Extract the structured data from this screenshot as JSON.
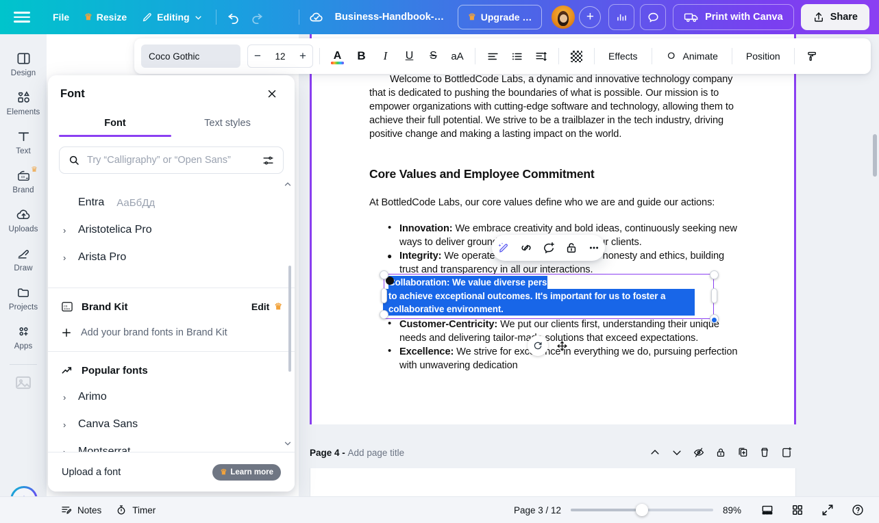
{
  "topbar": {
    "menu_icon": "hamburger-menu-icon",
    "file_label": "File",
    "resize_label": "Resize",
    "editing_label": "Editing",
    "undo_icon": "undo-icon",
    "redo_icon": "redo-icon",
    "cloud_icon": "cloud-saved-icon",
    "doc_title": "Business-Handbook-…",
    "upgrade_label": "Upgrade …",
    "insights_icon": "bar-chart-icon",
    "comment_icon": "comment-bubble-icon",
    "print_label": "Print with Canva",
    "share_label": "Share",
    "plus_label": "+"
  },
  "rail": {
    "items": [
      {
        "label": "Design",
        "icon": "design-icon"
      },
      {
        "label": "Elements",
        "icon": "elements-icon"
      },
      {
        "label": "Text",
        "icon": "text-icon"
      },
      {
        "label": "Brand",
        "icon": "brand-icon",
        "pro": true
      },
      {
        "label": "Uploads",
        "icon": "uploads-icon"
      },
      {
        "label": "Draw",
        "icon": "draw-icon"
      },
      {
        "label": "Projects",
        "icon": "projects-icon"
      },
      {
        "label": "Apps",
        "icon": "apps-icon"
      }
    ],
    "ai_assistant": "canva-ai-orb"
  },
  "toolbar": {
    "font_name": "Coco Gothic",
    "font_size": "12",
    "decrease_label": "−",
    "increase_label": "+",
    "text_color_icon": "text-color-A-icon",
    "bold_label": "B",
    "italic_label": "I",
    "underline_label": "U",
    "strikethrough_label": "S",
    "case_label": "aA",
    "align_icon": "align-left-icon",
    "list_icon": "bulleted-list-icon",
    "spacing_icon": "line-spacing-icon",
    "transparency_icon": "transparency-icon",
    "effects_label": "Effects",
    "animate_label": "Animate",
    "position_label": "Position",
    "copy_style_icon": "paint-roller-icon"
  },
  "font_panel": {
    "title": "Font",
    "close_icon": "close-icon",
    "tabs": [
      {
        "label": "Font",
        "active": true
      },
      {
        "label": "Text styles",
        "active": false
      }
    ],
    "search_placeholder": "Try “Calligraphy” or “Open Sans”",
    "search_value": "",
    "search_icon": "search-icon",
    "filter_icon": "filter-sliders-icon",
    "top_fonts": [
      {
        "name": "Entra",
        "sample": "АаБбДд",
        "chevron": false
      },
      {
        "name": "Aristotelica Pro",
        "sample": "",
        "chevron": true
      },
      {
        "name": "Arista Pro",
        "sample": "",
        "chevron": true
      }
    ],
    "brand_kit": {
      "title": "Brand Kit",
      "icon": "brand-kit-icon",
      "edit_label": "Edit",
      "add_label": "Add your brand fonts in Brand Kit",
      "add_icon": "plus-icon"
    },
    "popular": {
      "title": "Popular fonts",
      "icon": "trending-up-icon",
      "fonts": [
        {
          "name": "Arimo",
          "chevron": true
        },
        {
          "name": "Canva Sans",
          "chevron": true
        },
        {
          "name": "Montserrat",
          "chevron": true
        }
      ]
    },
    "footer": {
      "upload_label": "Upload a font",
      "learn_more_label": "Learn more"
    }
  },
  "document": {
    "intro": "Welcome to BottledCode Labs, a dynamic and innovative technology company that is dedicated to pushing the boundaries of what is possible. Our mission is to empower organizations with cutting-edge software and technology, allowing them to achieve their full potential. We strive to be a trailblazer in the tech industry, driving positive change and making a lasting impact on the world.",
    "heading": "Core Values and Employee Commitment",
    "lead": "At BottledCode Labs, our core values define who we are and guide our actions:",
    "bullets": [
      {
        "term": "Innovation:",
        "text": " We embrace creativity and bold ideas, continuously seeking new ways to deliver groundbreaking solutions for our clients."
      },
      {
        "term": "Integrity:",
        "text": " We operate with the highest level of honesty and ethics, building trust and transparency in all our interactions."
      },
      {
        "term": "Customer-Centricity:",
        "text": " We put our clients first, understanding their unique needs and delivering tailor-made solutions that exceed expectations."
      },
      {
        "term": "Excellence:",
        "text": " We strive for excellence in everything we do, pursuing perfection with unwavering dedication"
      }
    ],
    "selected_text": "Collaboration: We value diverse perspectives and work together as a team to achieve exceptional outcomes. It's important for us to foster a collaborative environment."
  },
  "mini_toolbar": {
    "magic_write_icon": "magic-write-sparkle-pen-icon",
    "link_icon": "link-icon",
    "comment_icon": "add-comment-icon",
    "lock_icon": "lock-icon",
    "more_icon": "more-options-icon"
  },
  "canvas_handles": {
    "rotate_icon": "rotate-handle-icon",
    "move_icon": "move-handle-icon"
  },
  "page_toolbar": {
    "page_label": "Page 4 -",
    "add_title_label": "Add page title",
    "move_up_icon": "chevron-up-icon",
    "move_down_icon": "chevron-down-icon",
    "hide_icon": "hide-page-icon",
    "lock_icon": "lock-page-icon",
    "duplicate_icon": "duplicate-page-icon",
    "delete_icon": "delete-page-icon",
    "add_icon": "add-page-icon"
  },
  "bottombar": {
    "notes_label": "Notes",
    "notes_icon": "notes-icon",
    "timer_label": "Timer",
    "timer_icon": "timer-icon",
    "page_indicator": "Page 3 / 12",
    "zoom_value": "89%",
    "zoom_percent": 50,
    "grid_view_icon": "page-view-icon",
    "thumbnails_icon": "grid-view-icon",
    "fullscreen_icon": "fullscreen-icon",
    "help_icon": "help-icon"
  },
  "colors": {
    "brand_purple": "#8b3ff2",
    "accent_teal": "#00c4cc",
    "selection_blue": "#1866e8",
    "crown_gold": "#f2a33c"
  }
}
